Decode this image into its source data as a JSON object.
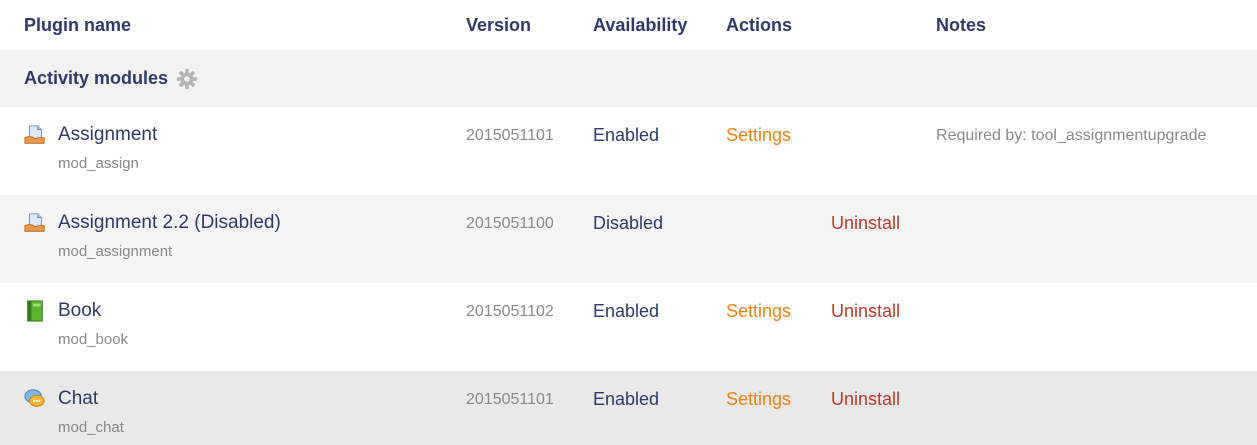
{
  "headers": {
    "plugin_name": "Plugin name",
    "version": "Version",
    "availability": "Availability",
    "actions": "Actions",
    "notes": "Notes"
  },
  "category": {
    "label": "Activity modules",
    "icon": "gear-icon"
  },
  "plugins": [
    {
      "name": "Assignment",
      "id": "mod_assign",
      "icon": "assignment-icon",
      "version": "2015051101",
      "availability": "Enabled",
      "settings": "Settings",
      "uninstall": "",
      "notes": "Required by: tool_assignmentupgrade"
    },
    {
      "name": "Assignment 2.2 (Disabled)",
      "id": "mod_assignment",
      "icon": "assignment-icon",
      "version": "2015051100",
      "availability": "Disabled",
      "settings": "",
      "uninstall": "Uninstall",
      "notes": ""
    },
    {
      "name": "Book",
      "id": "mod_book",
      "icon": "book-icon",
      "version": "2015051102",
      "availability": "Enabled",
      "settings": "Settings",
      "uninstall": "Uninstall",
      "notes": ""
    },
    {
      "name": "Chat",
      "id": "mod_chat",
      "icon": "chat-icon",
      "version": "2015051101",
      "availability": "Enabled",
      "settings": "Settings",
      "uninstall": "Uninstall",
      "notes": ""
    }
  ],
  "colors": {
    "heading": "#2f3a6b",
    "settings_link": "#f98012",
    "uninstall_link": "#c0392b",
    "muted_text": "#888888"
  }
}
